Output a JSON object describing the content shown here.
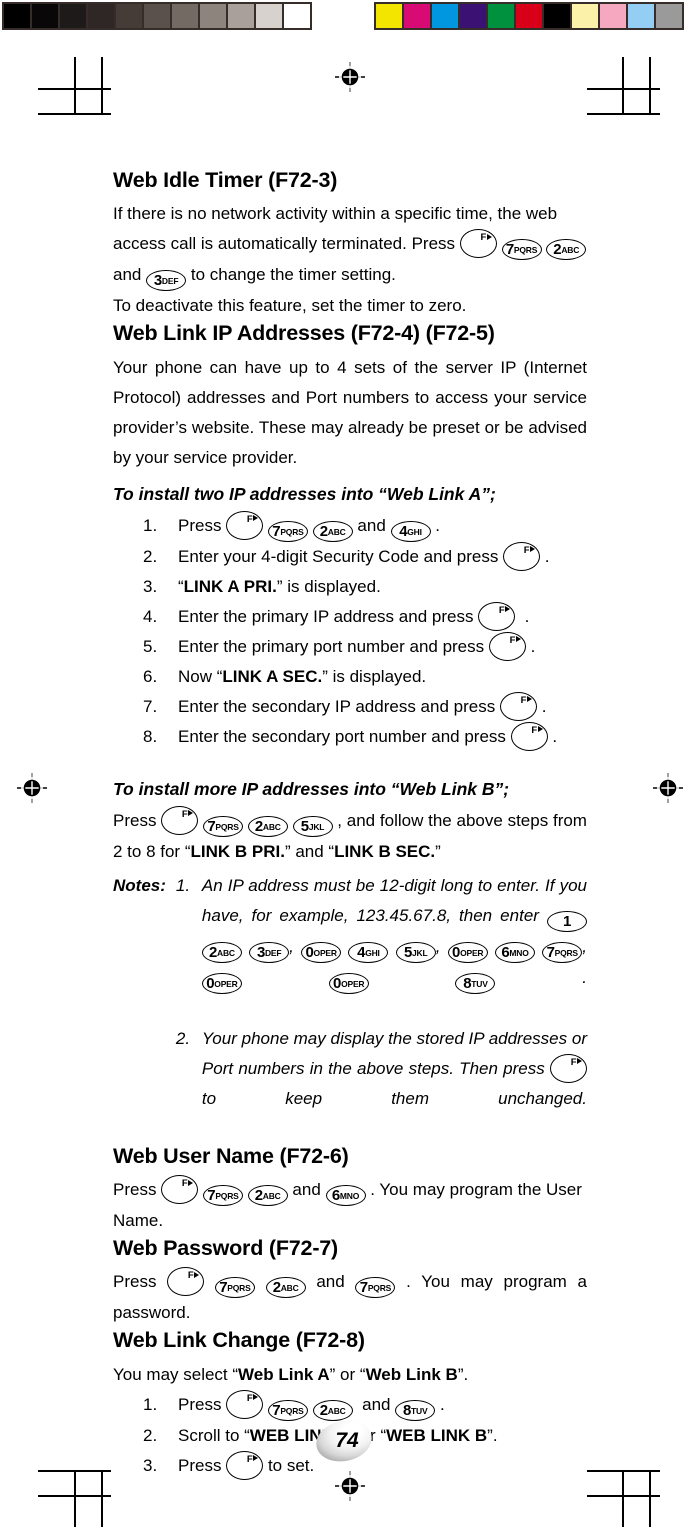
{
  "calibration": {
    "grayscale_label": "grayscale-calibration-strip",
    "grayscale_patches": [
      "#000000",
      "#0a0708",
      "#1d1a19",
      "#2e2725",
      "#453c37",
      "#5a514c",
      "#736a64",
      "#8d847d",
      "#a9a09a",
      "#d7d2cd",
      "#ffffff"
    ],
    "color_label": "color-calibration-strip",
    "color_patches": [
      "#f3e500",
      "#d80a74",
      "#0096e0",
      "#3b1273",
      "#00913f",
      "#d80019",
      "#000000",
      "#fbf1a8",
      "#f6a8c0",
      "#95cef5",
      "#9a9a9a"
    ]
  },
  "page": {
    "number": "74"
  },
  "sections": [
    {
      "id": "web-idle-timer",
      "heading": "Web Idle Timer (F72-3)"
    },
    {
      "id": "web-link-ip-addresses",
      "heading": "Web Link IP Addresses (F72-4) (F72-5)"
    },
    {
      "id": "web-user-name",
      "heading": "Web User Name (F72-6)"
    },
    {
      "id": "web-password",
      "heading": "Web Password (F72-7)"
    },
    {
      "id": "web-link-change",
      "heading": "Web Link Change (F72-8)"
    }
  ],
  "idle_timer": {
    "text_1": "If there is no network activity within a specific time, the web access call is automatically terminated. Press",
    "text_2": "and",
    "text_3": "to change the timer setting.",
    "text_4": "To deactivate this feature, set the timer to zero."
  },
  "ip_addresses": {
    "intro": "Your phone can have up to 4 sets of the server IP (Internet Protocol) addresses and Port numbers to access your service provider’s website. These may already be preset or be advised by your service provider.",
    "subhead_a": "To install two IP addresses into “Web Link A”;",
    "steps": [
      {
        "num": "1.",
        "pre": "Press",
        "post": "."
      },
      {
        "num": "2.",
        "pre": "Enter your 4-digit Security Code and press",
        "post": "."
      },
      {
        "num": "3.",
        "pre": "“",
        "strong": "LINK A PRI.",
        "post": "” is displayed."
      },
      {
        "num": "4.",
        "pre": "Enter the primary IP address and press",
        "post": "."
      },
      {
        "num": "5.",
        "pre": "Enter the primary port number and press",
        "post": "."
      },
      {
        "num": "6.",
        "pre": "Now “",
        "strong": "LINK A SEC.",
        "post": "” is displayed."
      },
      {
        "num": "7.",
        "pre": "Enter the secondary IP address and press",
        "post": "."
      },
      {
        "num": "8.",
        "pre": "Enter the secondary port number and press",
        "post": "."
      }
    ],
    "subhead_b": "To install more IP addresses into “Web Link B”;",
    "b_text_1": "Press",
    "b_text_2": ", and follow the above steps from 2 to 8 for “",
    "b_strong_1": "LINK B PRI.",
    "b_text_3": "” and “",
    "b_strong_2": "LINK B SEC.",
    "b_text_4": "”"
  },
  "notes": {
    "label": "Notes:",
    "note1_num": "1.",
    "note1_text_1": "An IP address must be 12-digit long to enter. If you have, for example, 123.45.67.8, then enter",
    "note1_sep1": ",",
    "note1_sep2": ",",
    "note1_sep3": ",",
    "note1_end": ".",
    "note2_num": "2.",
    "note2_text_1": "Your phone may display the stored IP addresses or Port numbers in the above steps. Then press",
    "note2_text_2": "to keep them unchanged."
  },
  "user_name": {
    "text_1": "Press",
    "text_2": "and",
    "text_3": ". You may program the User Name."
  },
  "password": {
    "text_1": "Press",
    "text_2": "and",
    "text_3": ". You may program a password."
  },
  "link_change": {
    "intro_1": "You may select “",
    "intro_strong_1": "Web Link A",
    "intro_2": "” or “",
    "intro_strong_2": "Web Link B",
    "intro_3": "”.",
    "step1_num": "1.",
    "step1_pre": "Press",
    "step1_mid": "and",
    "step1_post": ".",
    "step2_num": "2.",
    "step2_pre": "Scroll to “",
    "step2_strong_1": "WEB LINK A",
    "step2_mid": "” or “",
    "step2_strong_2": "WEB LINK B",
    "step2_post": "”.",
    "step3_num": "3.",
    "step3_pre": "Press",
    "step3_post": "to set."
  },
  "keys": {
    "f": {
      "label": "F",
      "name": "function-key"
    },
    "k1": {
      "digit": "1",
      "letters": ""
    },
    "k2": {
      "digit": "2",
      "letters": "ABC"
    },
    "k3": {
      "digit": "3",
      "letters": "DEF"
    },
    "k4": {
      "digit": "4",
      "letters": "GHI"
    },
    "k5": {
      "digit": "5",
      "letters": "JKL"
    },
    "k6": {
      "digit": "6",
      "letters": "MNO"
    },
    "k7": {
      "digit": "7",
      "letters": "PQRS"
    },
    "k8": {
      "digit": "8",
      "letters": "TUV"
    },
    "k0": {
      "digit": "0",
      "letters": "OPER"
    }
  }
}
